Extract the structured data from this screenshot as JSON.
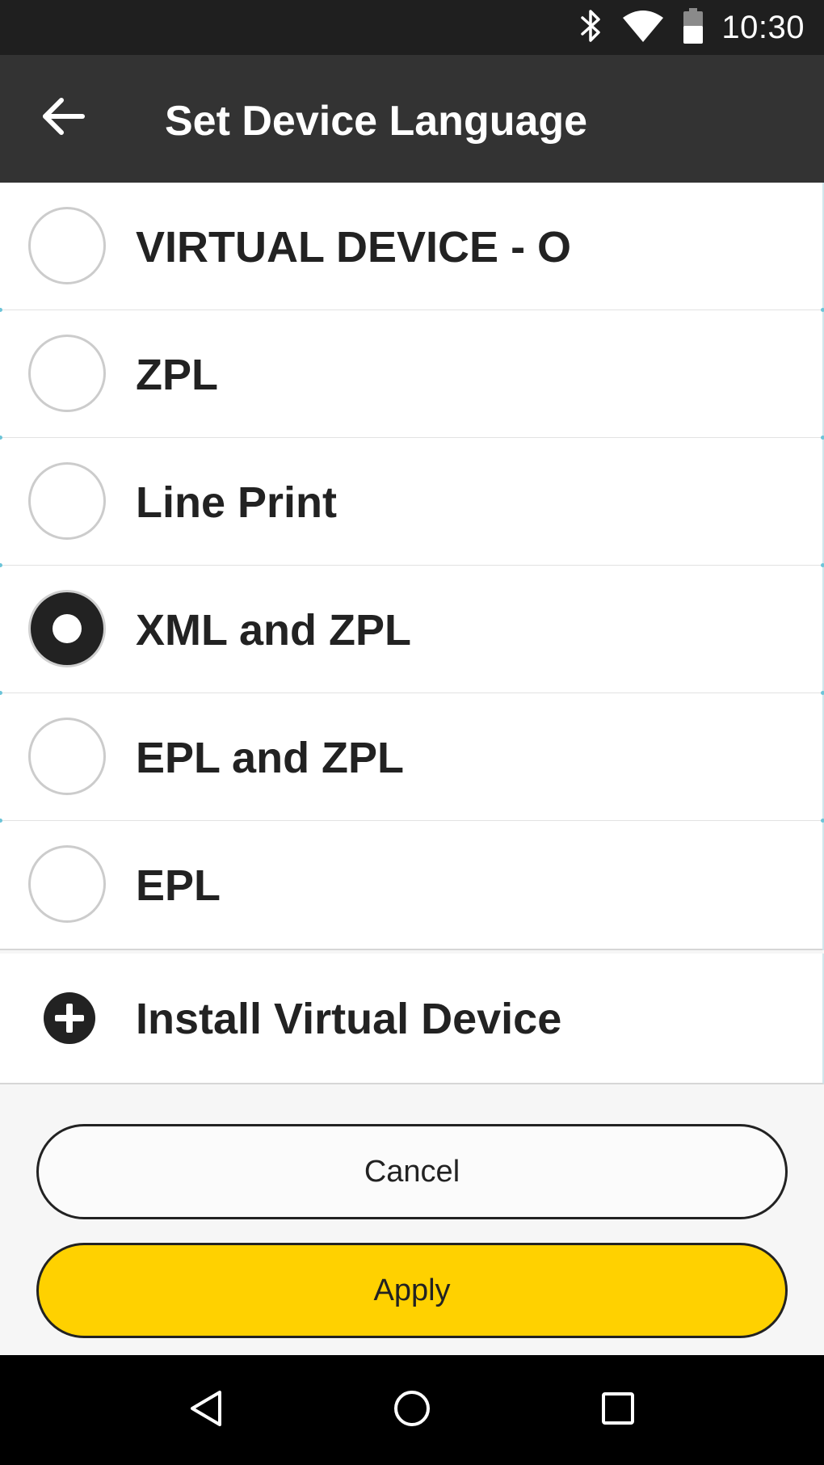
{
  "status_bar": {
    "time": "10:30",
    "icons": [
      "bluetooth-icon",
      "wifi-icon",
      "battery-icon"
    ]
  },
  "app_bar": {
    "title": "Set Device Language",
    "back_icon": "arrow-left-icon"
  },
  "options": [
    {
      "label": "VIRTUAL DEVICE - O",
      "selected": false
    },
    {
      "label": "ZPL",
      "selected": false
    },
    {
      "label": "Line Print",
      "selected": false
    },
    {
      "label": "XML and ZPL",
      "selected": true
    },
    {
      "label": "EPL and ZPL",
      "selected": false
    },
    {
      "label": "EPL",
      "selected": false
    }
  ],
  "install": {
    "label": "Install Virtual Device",
    "icon": "plus-circle-icon"
  },
  "buttons": {
    "cancel_label": "Cancel",
    "apply_label": "Apply"
  },
  "colors": {
    "accent": "#ffd100",
    "app_bar": "#333333",
    "status_bar": "#1f1f1f"
  },
  "nav_bar": {
    "icons": [
      "back-triangle-icon",
      "home-circle-icon",
      "recents-square-icon"
    ]
  }
}
